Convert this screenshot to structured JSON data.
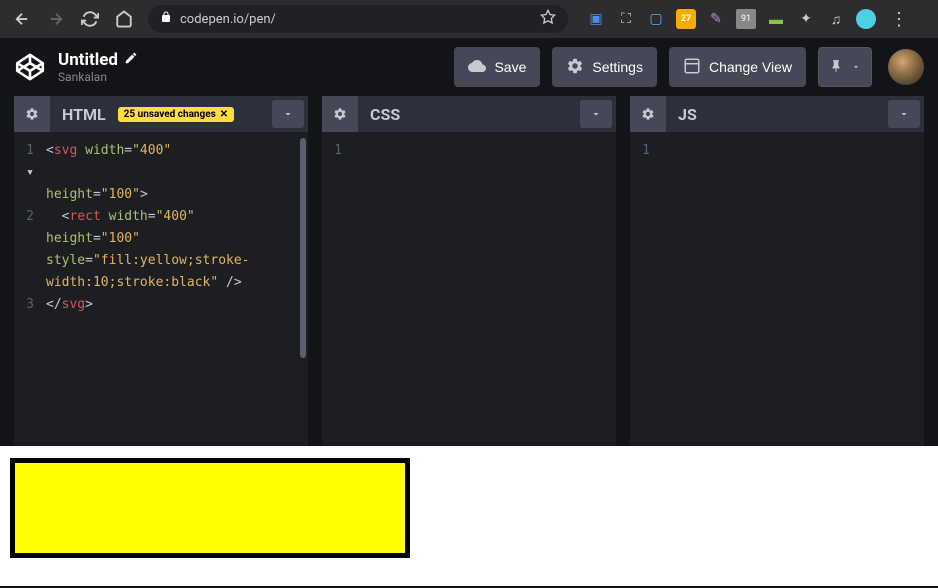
{
  "browser": {
    "url": "codepen.io/pen/",
    "extension_badge": "27"
  },
  "header": {
    "title": "Untitled",
    "author": "Sankalan",
    "save": "Save",
    "settings": "Settings",
    "change_view": "Change View"
  },
  "editors": {
    "html": {
      "title": "HTML",
      "unsaved": "25 unsaved changes",
      "lines": {
        "l1_num": "1",
        "l2_num": "2",
        "l3_num": "3"
      },
      "code": {
        "l1_open": "<",
        "l1_svg": "svg",
        "l1_sp1": " ",
        "l1_width": "width",
        "l1_eq": "=",
        "l1_wv": "\"400\"",
        "l1b_height": "height",
        "l1b_hv": "\"100\"",
        "l1b_close": ">",
        "l2_indent": "  <",
        "l2_rect": "rect",
        "l2_sp1": " ",
        "l2_width": "width",
        "l2_wv": "\"400\"",
        "l2b_height": "height",
        "l2b_hv": "\"100\"",
        "l2c_style": "style",
        "l2c_sv1": "\"fill:yellow;stroke-",
        "l2d_sv2": "width:10;stroke:black\"",
        "l2d_close": " />",
        "l3_open": "</",
        "l3_svg": "svg",
        "l3_close": ">"
      }
    },
    "css": {
      "title": "CSS",
      "line1": "1"
    },
    "js": {
      "title": "JS",
      "line1": "1"
    }
  },
  "output": {
    "rect_width": "400",
    "rect_height": "100",
    "rect_fill": "yellow",
    "rect_stroke": "black",
    "rect_stroke_width": "10"
  }
}
